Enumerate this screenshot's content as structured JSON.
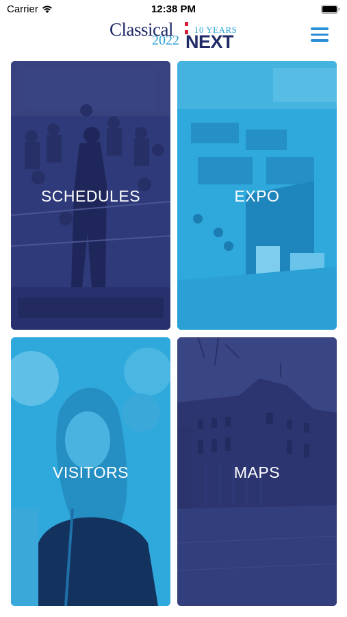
{
  "status_bar": {
    "carrier": "Carrier",
    "time": "12:38 PM"
  },
  "header": {
    "logo": {
      "classical": "Classical",
      "years": "10 YEARS",
      "year": "2022",
      "next": "NEXT"
    },
    "menu_icon": "hamburger-menu-icon"
  },
  "tiles": [
    {
      "label": "SCHEDULES",
      "color": "#2e3878"
    },
    {
      "label": "EXPO",
      "color": "#2ea9dd"
    },
    {
      "label": "VISITORS",
      "color": "#2ea9dd"
    },
    {
      "label": "MAPS",
      "color": "#2e3878"
    }
  ],
  "colors": {
    "navy": "#1f2a66",
    "accent_blue": "#2aa0d8",
    "menu_blue": "#2a8fd6",
    "logo_red": "#d31f3a"
  }
}
